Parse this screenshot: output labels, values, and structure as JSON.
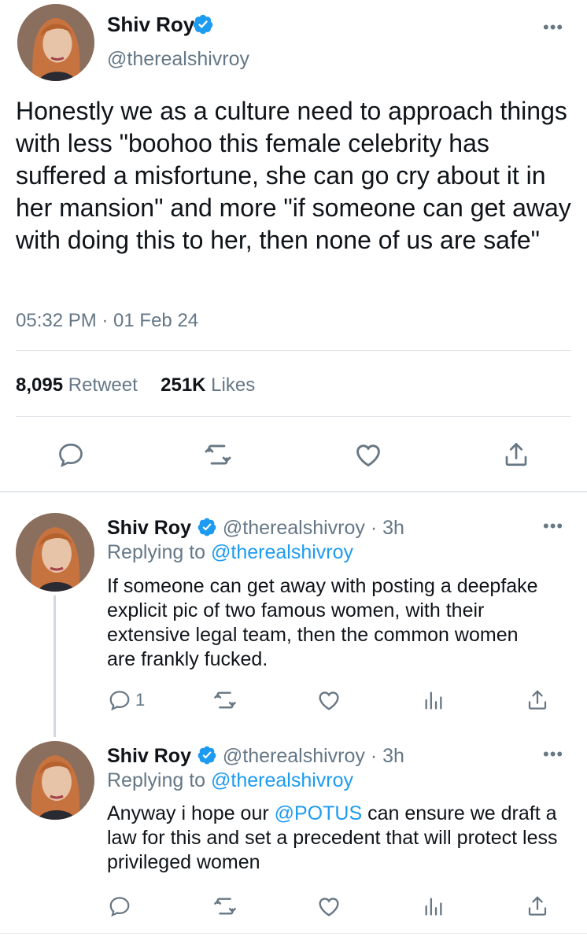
{
  "main_tweet": {
    "name": "Shiv Roy",
    "handle": "@therealshivroy",
    "text": "Honestly we as a culture need to approach things with less \"boohoo this female celebrity has suffered a misfortune, she can go cry about it in her mansion\" and more \"if someone can get away with doing this to her, then none of us are safe\"",
    "timestamp": "05:32 PM · 01 Feb 24",
    "retweet_count": "8,095",
    "retweet_label": "Retweet",
    "like_count": "251K",
    "like_label": "Likes"
  },
  "replies": [
    {
      "name": "Shiv Roy",
      "handle_time": "@therealshivroy · 3h",
      "replying_prefix": "Replying to",
      "replying_to": "@therealshivroy",
      "text": "If someone can get away with posting a deepfake explicit pic of two famous women, with their extensive legal team, then the common women are frankly fucked.",
      "reply_count": "1"
    },
    {
      "name": "Shiv Roy",
      "handle_time": "@therealshivroy · 3h",
      "replying_prefix": "Replying to",
      "replying_to": "@therealshivroy",
      "text_before": "Anyway i hope our ",
      "mention": "@POTUS",
      "text_after": " can ensure we draft a law for this and set a precedent that will protect less privileged women"
    }
  ],
  "more_label": "•••",
  "colors": {
    "accent": "#1d9bf0",
    "icon_gray": "#687784",
    "text": "#0f1419",
    "muted": "#657786"
  },
  "icons": [
    "verified-badge-icon",
    "reply-icon",
    "retweet-icon",
    "like-icon",
    "share-icon",
    "analytics-icon",
    "more-icon"
  ]
}
